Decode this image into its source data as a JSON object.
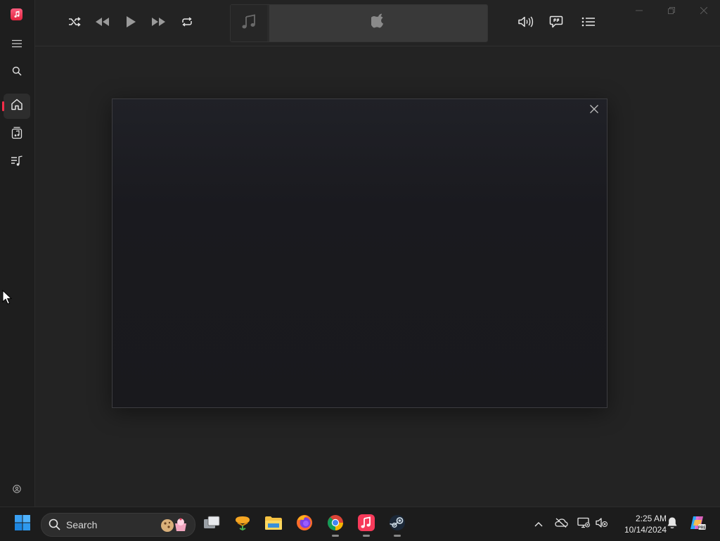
{
  "app": {
    "name": "Apple Music",
    "accent": "#fa2d48"
  },
  "sidebar": {
    "items": [
      {
        "name": "menu",
        "icon": "hamburger-icon",
        "active": false
      },
      {
        "name": "search",
        "icon": "search-icon",
        "active": false
      },
      {
        "name": "home",
        "icon": "home-icon",
        "active": true
      },
      {
        "name": "library",
        "icon": "library-icon",
        "active": false
      },
      {
        "name": "playlists",
        "icon": "playlist-icon",
        "active": false
      }
    ],
    "account_icon": "account-icon"
  },
  "player": {
    "controls": [
      "shuffle-icon",
      "previous-icon",
      "play-icon",
      "next-icon",
      "repeat-icon"
    ],
    "right_controls": [
      "volume-icon",
      "lyrics-icon",
      "queue-icon"
    ],
    "lcd_logo": "apple-logo"
  },
  "window_controls": [
    "minimize",
    "maximize",
    "close"
  ],
  "dialog": {
    "close_icon": "close-icon"
  },
  "taskbar": {
    "search_placeholder": "Search",
    "apps": [
      {
        "name": "start",
        "running": false
      },
      {
        "name": "task-view",
        "running": false
      },
      {
        "name": "app-orange",
        "running": false
      },
      {
        "name": "file-explorer",
        "running": false
      },
      {
        "name": "firefox",
        "running": false
      },
      {
        "name": "chrome",
        "running": true
      },
      {
        "name": "apple-music",
        "running": true
      },
      {
        "name": "steam",
        "running": true
      }
    ],
    "clock": {
      "time": "2:25 AM",
      "date": "10/14/2024"
    }
  }
}
